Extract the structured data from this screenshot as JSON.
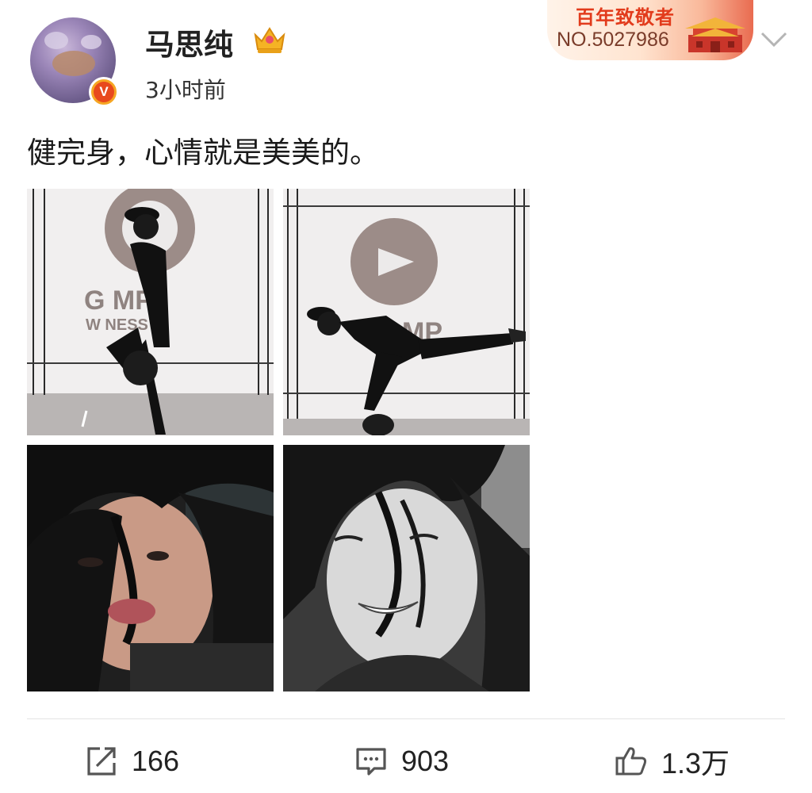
{
  "post": {
    "author": {
      "name": "马思纯",
      "verified_badge": "V",
      "vip_icon": "crown-icon"
    },
    "time": "3小时前",
    "fan_card": {
      "title": "百年致敬者",
      "number": "NO.5027986"
    },
    "text": "健完身，心情就是美美的。",
    "images": [
      {
        "name": "photo-1",
        "desc_icon": "photo"
      },
      {
        "name": "photo-2",
        "desc_icon": "photo"
      },
      {
        "name": "photo-3",
        "desc_icon": "photo"
      },
      {
        "name": "photo-4",
        "desc_icon": "photo"
      }
    ],
    "gym_sign": {
      "line1": "G  MP",
      "line2": "W    NESS",
      "line3": "MP"
    }
  },
  "actions": {
    "repost": {
      "count": "166",
      "icon": "repost-icon"
    },
    "comment": {
      "count": "903",
      "icon": "comment-icon"
    },
    "like": {
      "count": "1.3万",
      "icon": "thumbs-up-icon"
    }
  },
  "colors": {
    "accent_red": "#e23b1c",
    "badge_orange": "#f6a623",
    "text_dark": "#1a1a1a"
  }
}
